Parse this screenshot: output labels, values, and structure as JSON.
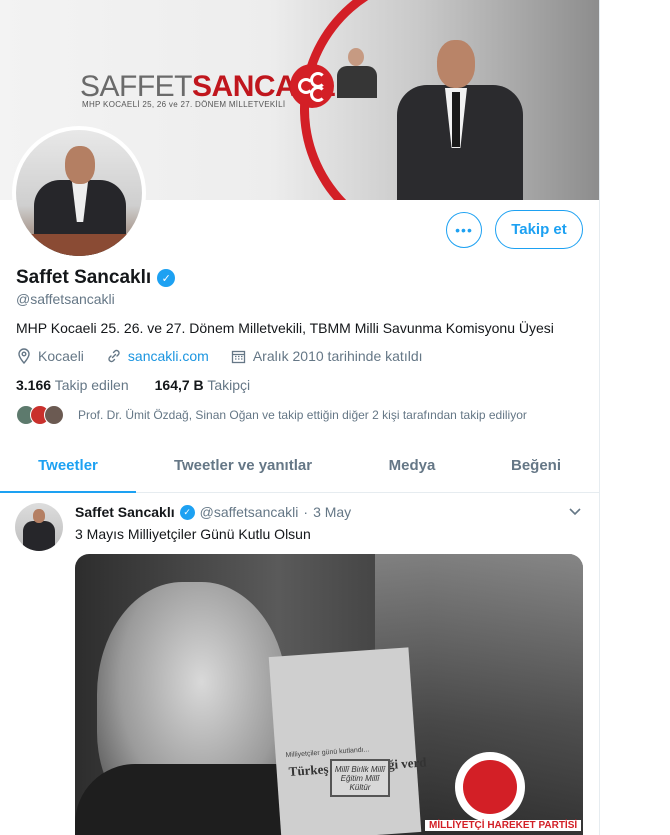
{
  "banner": {
    "brand_first": "SAFFET",
    "brand_last": "SANCAKLI",
    "subtitle": "MHP KOCAELİ 25, 26 ve 27. DÖNEM MİLLETVEKİLİ"
  },
  "profile": {
    "name": "Saffet Sancaklı",
    "handle": "@saffetsancakli",
    "bio": "MHP Kocaeli 25. 26. ve 27. Dönem Milletvekili, TBMM Milli Savunma Komisyonu Üyesi",
    "location": "Kocaeli",
    "website": "sancakli.com",
    "joined": "Aralık 2010 tarihinde katıldı",
    "following_count": "3.166",
    "following_label": "Takip edilen",
    "followers_count": "164,7 B",
    "followers_label": "Takipçi",
    "followed_by": "Prof. Dr. Ümit Özdağ, Sinan Oğan ve takip ettiğin diğer 2 kişi tarafından takip ediliyor"
  },
  "actions": {
    "more_label": "•••",
    "follow_label": "Takip et"
  },
  "tabs": [
    {
      "label": "Tweetler",
      "active": true
    },
    {
      "label": "Tweetler ve yanıtlar",
      "active": false
    },
    {
      "label": "Medya",
      "active": false
    },
    {
      "label": "Beğeni",
      "active": false
    }
  ],
  "tweet": {
    "name": "Saffet Sancaklı",
    "handle": "@saffetsancakli",
    "separator": "·",
    "date": "3 May",
    "text": "3 Mayıs Milliyetçiler Günü Kutlu Olsun",
    "media": {
      "headline": "Türkeş iftar yemeği verd",
      "small_text": "Milliyetçiler günü kutlandı...",
      "box_text": "Millî Birlik Millî Eğitim Millî Kültür",
      "party": "MİLLİYETÇİ HAREKET PARTİSİ"
    }
  },
  "icons": {
    "verified": "verified-badge-icon",
    "location": "location-pin-icon",
    "link": "link-icon",
    "calendar": "calendar-icon",
    "chevron": "chevron-down-icon"
  },
  "colors": {
    "accent": "#1da1f2",
    "link": "#1b95e0",
    "muted": "#657786",
    "party_red": "#d31f26"
  }
}
